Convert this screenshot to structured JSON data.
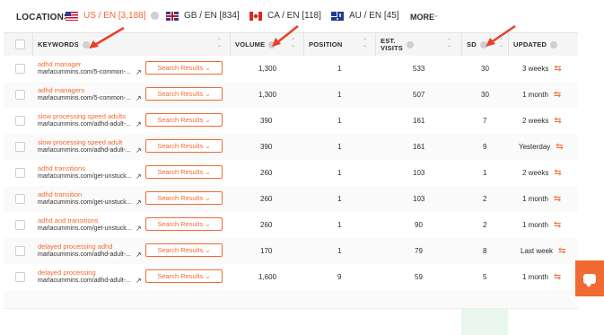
{
  "locations": {
    "label": "LOCATIONS",
    "items": [
      {
        "flag": "us-flag",
        "text": "US / EN [3,188]",
        "active": true
      },
      {
        "flag": "gb-flag",
        "text": "GB / EN [834]",
        "active": false
      },
      {
        "flag": "ca-flag",
        "text": "CA / EN [118]",
        "active": false
      },
      {
        "flag": "au-flag",
        "text": "AU / EN [45]",
        "active": false
      }
    ],
    "more_label": "MORE",
    "more_chevron": "⌄"
  },
  "table": {
    "headers": {
      "keywords": "KEYWORDS",
      "volume": "VOLUME",
      "position": "POSITION",
      "est_visits_1": "EST.",
      "est_visits_2": "VISITS",
      "sd": "SD",
      "updated": "UPDATED"
    },
    "button_label": "Search Results ⌄",
    "rows": [
      {
        "keyword": "adhd manager",
        "url": "marlacummins.com/5-common-...",
        "volume": "1,300",
        "position": "1",
        "visits": "533",
        "sd": "30",
        "updated": "3 weeks"
      },
      {
        "keyword": "adhd managers",
        "url": "marlacummins.com/5-common-...",
        "volume": "1,300",
        "position": "1",
        "visits": "507",
        "sd": "30",
        "updated": "1 month"
      },
      {
        "keyword": "slow processing speed adults",
        "url": "marlacummins.com/adhd-adult-...",
        "volume": "390",
        "position": "1",
        "visits": "161",
        "sd": "7",
        "updated": "2 weeks"
      },
      {
        "keyword": "slow processing speed adult",
        "url": "marlacummins.com/adhd-adult-...",
        "volume": "390",
        "position": "1",
        "visits": "161",
        "sd": "9",
        "updated": "Yesterday"
      },
      {
        "keyword": "adhd transitions",
        "url": "marlacummins.com/get-unstuck...",
        "volume": "260",
        "position": "1",
        "visits": "103",
        "sd": "1",
        "updated": "2 weeks"
      },
      {
        "keyword": "adhd transition",
        "url": "marlacummins.com/get-unstuck...",
        "volume": "260",
        "position": "1",
        "visits": "103",
        "sd": "2",
        "updated": "1 month"
      },
      {
        "keyword": "adhd and transitions",
        "url": "marlacummins.com/get-unstuck...",
        "volume": "260",
        "position": "1",
        "visits": "90",
        "sd": "2",
        "updated": "1 month"
      },
      {
        "keyword": "delayed processing adhd",
        "url": "marlacummins.com/adhd-adult-...",
        "volume": "170",
        "position": "1",
        "visits": "79",
        "sd": "8",
        "updated": "Last week"
      },
      {
        "keyword": "delayed processing",
        "url": "marlacummins.com/adhd-adult-...",
        "volume": "1,600",
        "position": "9",
        "visits": "59",
        "sd": "5",
        "updated": "1 month"
      }
    ]
  },
  "colors": {
    "accent": "#f26a33",
    "sd_highlight": "#e9f6ee",
    "header_bg": "#f5f5f5"
  },
  "icons": {
    "external_link": "↗",
    "refresh": "⇆",
    "sort": "⌃⌄",
    "chat": "chat-icon"
  }
}
